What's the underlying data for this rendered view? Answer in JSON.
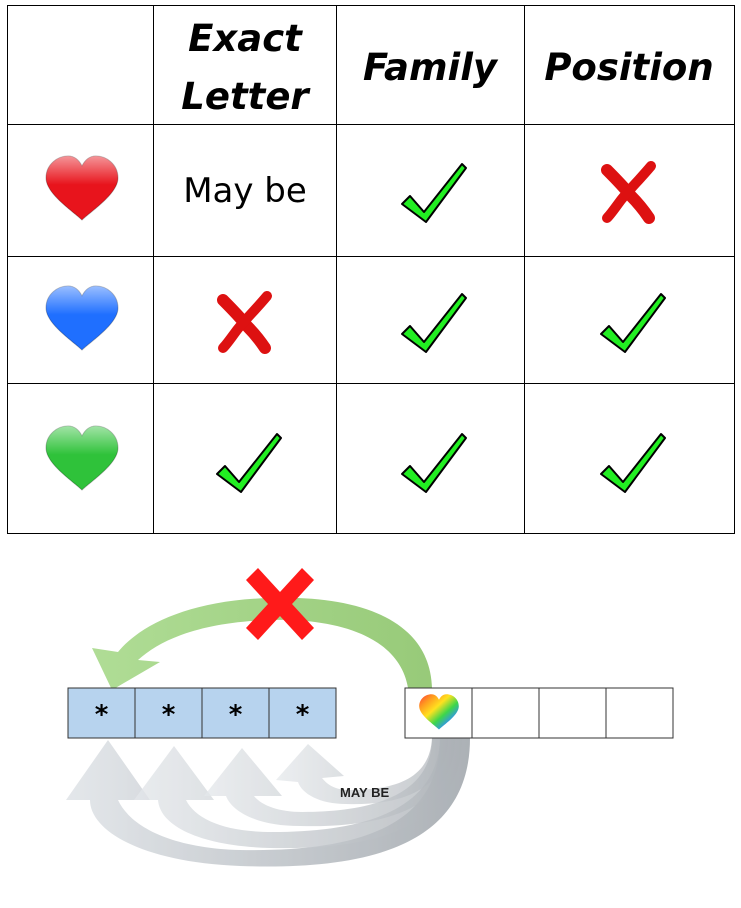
{
  "table": {
    "headers": {
      "col1_line1": "Exact",
      "col1_line2": "Letter",
      "col2": "Family",
      "col3": "Position"
    },
    "rows": [
      {
        "heart": "red-heart-icon",
        "heart_color": "#e8141c",
        "exact": "text",
        "exact_text": "May be",
        "family": "check",
        "position": "cross"
      },
      {
        "heart": "blue-heart-icon",
        "heart_color": "#1f6fff",
        "exact": "cross",
        "family": "check",
        "position": "check"
      },
      {
        "heart": "green-heart-icon",
        "heart_color": "#2fc23a",
        "exact": "check",
        "family": "check",
        "position": "check"
      }
    ],
    "check_color": "#22ee22",
    "cross_color": "#dd1111"
  },
  "diagram": {
    "left_slots": [
      "*",
      "*",
      "*",
      "*"
    ],
    "left_slot_color": "#b7d3ee",
    "right_slots": [
      "rainbow-heart-icon",
      "",
      "",
      ""
    ],
    "top_arrow_color": "#9fd07a",
    "bottom_arrow_color": "#c8cdd2",
    "x_color": "#ff1a1a",
    "maybe_label": "MAY BE"
  }
}
